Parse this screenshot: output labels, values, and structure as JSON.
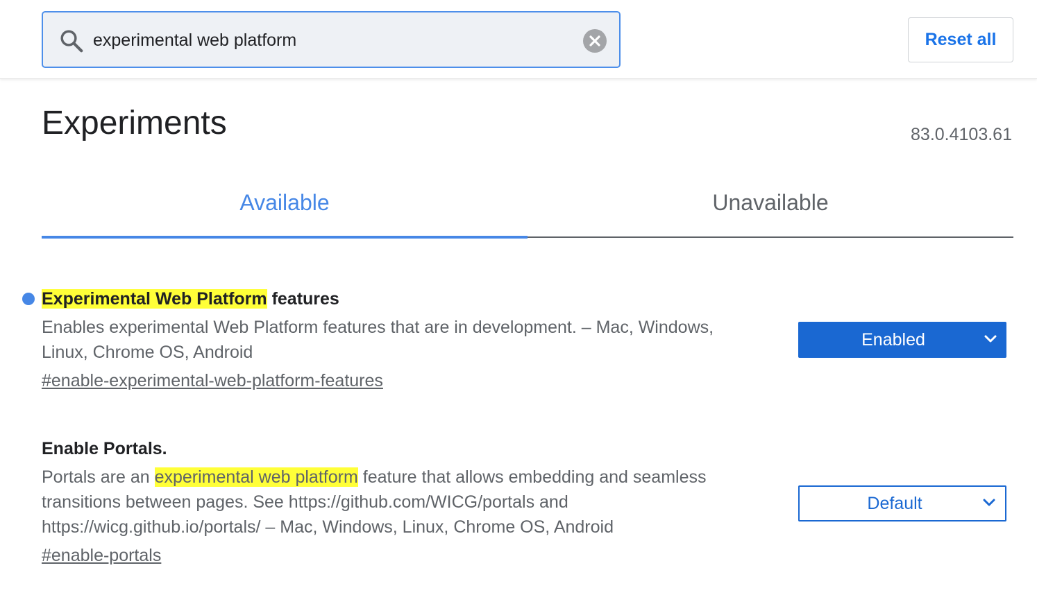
{
  "search": {
    "value": "experimental web platform",
    "icon": "search-icon",
    "clear_icon": "close-icon"
  },
  "header": {
    "reset_label": "Reset all"
  },
  "page": {
    "title": "Experiments",
    "version": "83.0.4103.61"
  },
  "tabs": [
    {
      "label": "Available",
      "selected": true
    },
    {
      "label": "Unavailable",
      "selected": false
    }
  ],
  "experiments": [
    {
      "title_highlight": "Experimental Web Platform",
      "title_rest": " features",
      "description": "Enables experimental Web Platform features that are in development. – Mac, Windows, Linux, Chrome OS, Android",
      "link": "#enable-experimental-web-platform-features",
      "state": "Enabled",
      "modified": true
    },
    {
      "title": "Enable Portals.",
      "description_before": "Portals are an ",
      "description_highlight": "experimental web platform",
      "description_after": " feature that allows embedding and seamless transitions between pages. See https://github.com/WICG/portals and https://wicg.github.io/portals/ – Mac, Windows, Linux, Chrome OS, Android",
      "link": "#enable-portals",
      "state": "Default",
      "modified": false
    }
  ],
  "colors": {
    "accent": "#1a73e8",
    "tab_active": "#4687e6",
    "highlight": "#ffff38",
    "enabled_select_bg": "#1a68d2"
  }
}
